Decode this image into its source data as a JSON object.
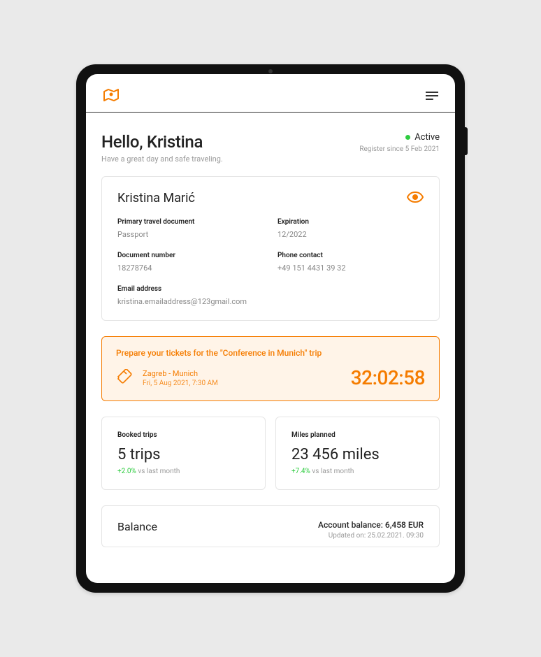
{
  "header": {
    "greeting": "Hello, Kristina",
    "tagline": "Have a great day and safe traveling.",
    "status": "Active",
    "register_since": "Register since 5 Feb 2021"
  },
  "profile": {
    "name": "Kristina Marić",
    "fields": {
      "primary_doc_label": "Primary travel document",
      "primary_doc_value": "Passport",
      "expiration_label": "Expiration",
      "expiration_value": "12/2022",
      "doc_number_label": "Document number",
      "doc_number_value": "18278764",
      "phone_label": "Phone contact",
      "phone_value": "+49 151 4431 39 32",
      "email_label": "Email address",
      "email_value": "kristina.emailaddress@123gmail.com"
    }
  },
  "alert": {
    "title": "Prepare your tickets for the \"Conference in Munich\" trip",
    "route": "Zagreb - Munich",
    "datetime": "Fri, 5 Aug 2021, 7:30 AM",
    "countdown": "32:02:58"
  },
  "stats": {
    "booked": {
      "label": "Booked trips",
      "value": "5 trips",
      "delta": "+2.0%",
      "delta_desc": " vs last month"
    },
    "miles": {
      "label": "Miles planned",
      "value": "23 456 miles",
      "delta": "+7.4%",
      "delta_desc": " vs last month"
    }
  },
  "balance": {
    "title": "Balance",
    "amount": "Account balance: 6,458 EUR",
    "updated": "Updated on: 25.02.2021. 09:30"
  }
}
